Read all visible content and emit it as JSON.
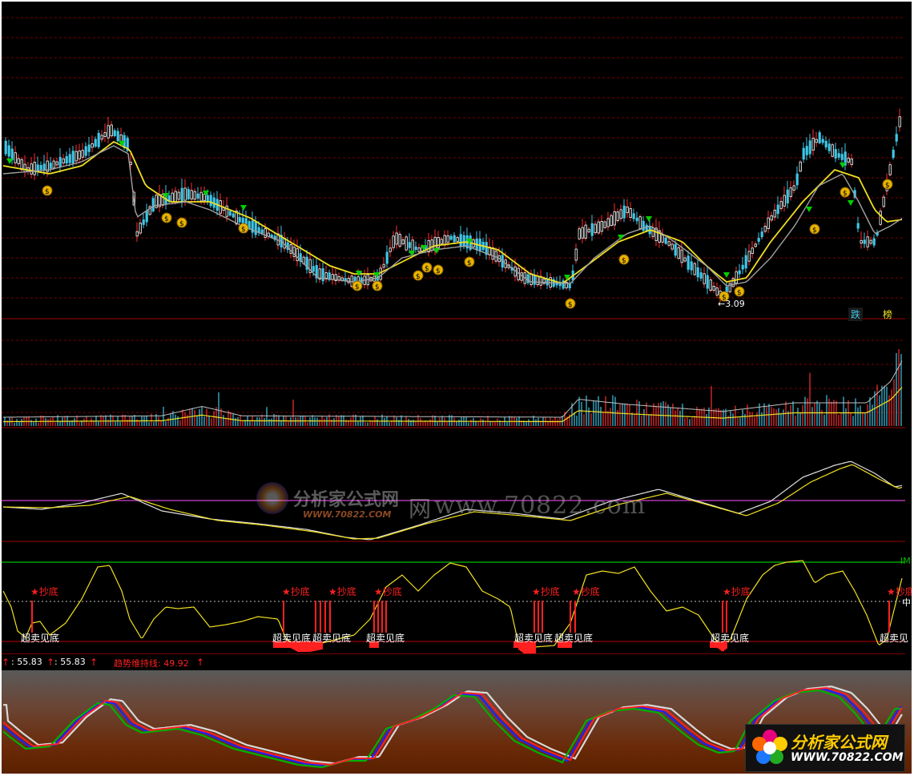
{
  "main": {
    "low_marker": "3.09",
    "buttons": {
      "fall": "跌",
      "rank": "榜"
    },
    "colors": {
      "up": "#ffffff",
      "down": "#3fc6e6",
      "ma_yellow": "#f0e020",
      "ma_gray": "#a0a0a0",
      "buy_arrow": "#00d000",
      "coin": "#e8b400",
      "grid": "#7a0000"
    }
  },
  "oscillator": {
    "watermark_url": "www.70822.com",
    "watermark_cn": "分析家公式网",
    "watermark_sub": "WWW.70822.COM",
    "watermark_net": "网"
  },
  "signal": {
    "buy_label": "★抄底",
    "oversold_label": "超卖见底",
    "buy_labels": [
      "★抄底",
      "★抄底",
      "★抄底",
      "★抄底",
      "★抄底",
      "★抄底",
      "★抄底",
      "★抄底"
    ],
    "oversold_labels": [
      "超卖见底",
      "超卖见底",
      "超卖见底",
      "超卖见底",
      "超卖见底",
      "超卖见底",
      "超卖见底",
      "超卖见"
    ],
    "right_cut_labels": [
      "IM",
      "中"
    ]
  },
  "status_line": {
    "v1": ": 55.83",
    "v2": ": 55.83",
    "trend_label": "趋势维持线: 49.92",
    "arrow": "↑"
  },
  "logo": {
    "cn": "分析家公式网",
    "url": "WWW.70822.COM"
  }
}
